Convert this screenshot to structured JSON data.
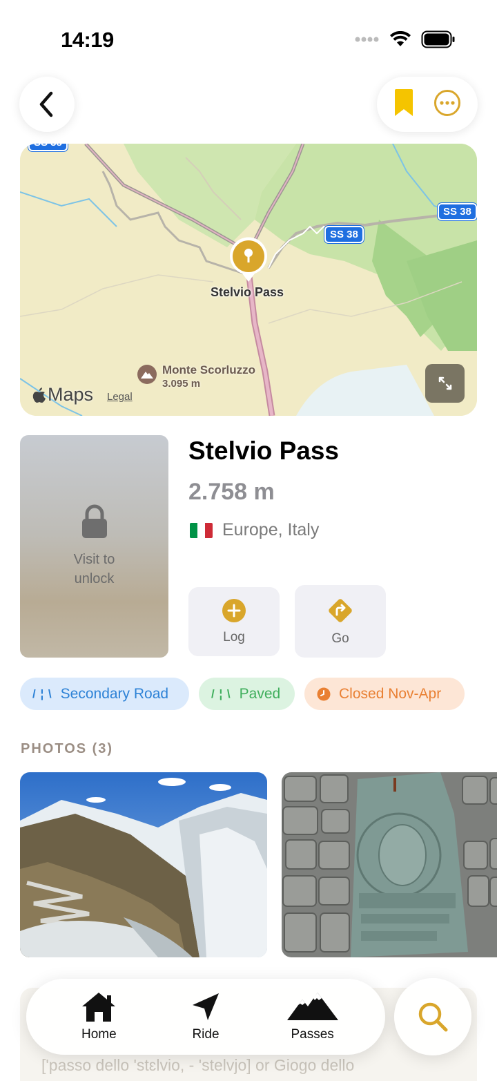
{
  "status_bar": {
    "time": "14:19",
    "icons": [
      "signal-dots-icon",
      "wifi-icon",
      "battery-icon"
    ]
  },
  "nav": {
    "back_icon": "chevron-left-icon",
    "bookmark_icon": "bookmark-icon",
    "more_icon": "ellipsis-circle-icon"
  },
  "map": {
    "pin_label": "Stelvio Pass",
    "shield_top": "SS 38",
    "shield_mid": "SS 38",
    "shield_right": "SS 38",
    "peak_name": "Monte Scorluzzo",
    "peak_elevation": "3.095 m",
    "brand": "Maps",
    "legal": "Legal"
  },
  "pass": {
    "lock_text": "Visit to unlock",
    "name": "Stelvio Pass",
    "elevation": "2.758 m",
    "location": "Europe, Italy",
    "flag_colors": [
      "#009246",
      "#ffffff",
      "#ce2b37"
    ]
  },
  "actions": {
    "log_label": "Log",
    "go_label": "Go"
  },
  "chips": {
    "road_glyph": "/ ¦ \\",
    "road_label": "Secondary Road",
    "paved_glyph": "/ ¦ \\",
    "paved_label": "Paved",
    "closed_label": "Closed Nov-Apr"
  },
  "photos": {
    "header": "PHOTOS (3)"
  },
  "description": {
    "visible_line": "['passo dello 'stɛlvio, - 'stelvjo] or Giogo dello"
  },
  "tabbar": {
    "home": "Home",
    "ride": "Ride",
    "passes": "Passes"
  },
  "colors": {
    "accent_gold": "#d9a62b",
    "road_blue": "#2d82d6",
    "paved_green": "#3fae5c",
    "closed_orange": "#e98033"
  }
}
